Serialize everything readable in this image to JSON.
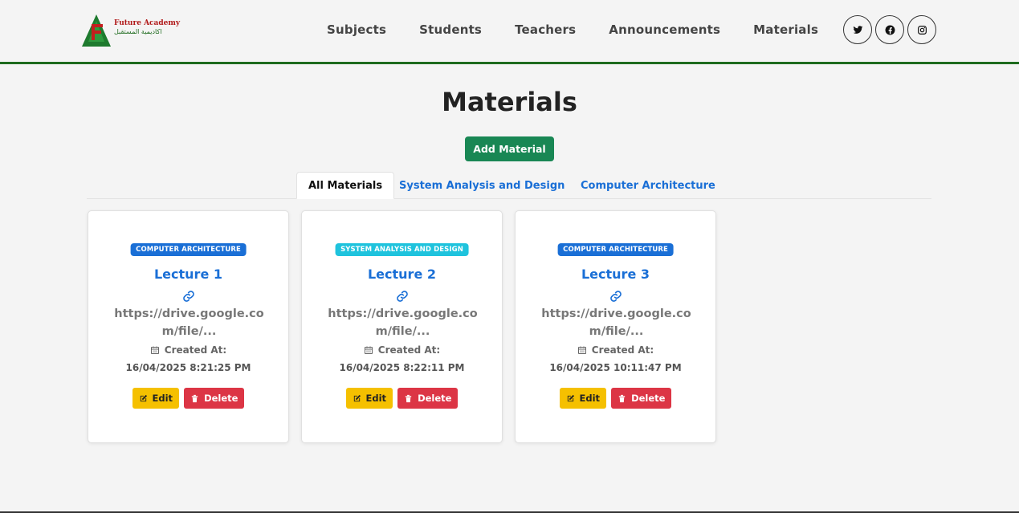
{
  "brand": {
    "name_en": "Future Academy",
    "name_ar": "اكاديمية المستقبل"
  },
  "nav": {
    "links": [
      "Subjects",
      "Students",
      "Teachers",
      "Announcements",
      "Materials"
    ],
    "socials": [
      "twitter-icon",
      "facebook-icon",
      "instagram-icon"
    ]
  },
  "page": {
    "title": "Materials",
    "add_label": "Add Material"
  },
  "tabs": [
    {
      "label": "All Materials",
      "active": true
    },
    {
      "label": "System Analysis and Design",
      "active": false
    },
    {
      "label": "Computer Architecture",
      "active": false
    }
  ],
  "cards": [
    {
      "badge": "COMPUTER ARCHITECTURE",
      "badge_color": "#1a6fd6",
      "title": "Lecture 1",
      "url": "https://drive.google.com/file/...",
      "created_label": "Created At:",
      "date": "16/04/2025 8:21:25 PM",
      "edit_label": "Edit",
      "delete_label": "Delete"
    },
    {
      "badge": "SYSTEM ANALYSIS AND DESIGN",
      "badge_color": "#1fc3dd",
      "title": "Lecture 2",
      "url": "https://drive.google.com/file/...",
      "created_label": "Created At:",
      "date": "16/04/2025 8:22:11 PM",
      "edit_label": "Edit",
      "delete_label": "Delete"
    },
    {
      "badge": "COMPUTER ARCHITECTURE",
      "badge_color": "#1a6fd6",
      "title": "Lecture 3",
      "url": "https://drive.google.com/file/...",
      "created_label": "Created At:",
      "date": "16/04/2025 10:11:47 PM",
      "edit_label": "Edit",
      "delete_label": "Delete"
    }
  ],
  "colors": {
    "accent_green": "#198754",
    "nav_border": "#1e6b1e",
    "link_blue": "#1a6fd6",
    "edit_yellow": "#f5c000",
    "delete_red": "#dc3545"
  }
}
